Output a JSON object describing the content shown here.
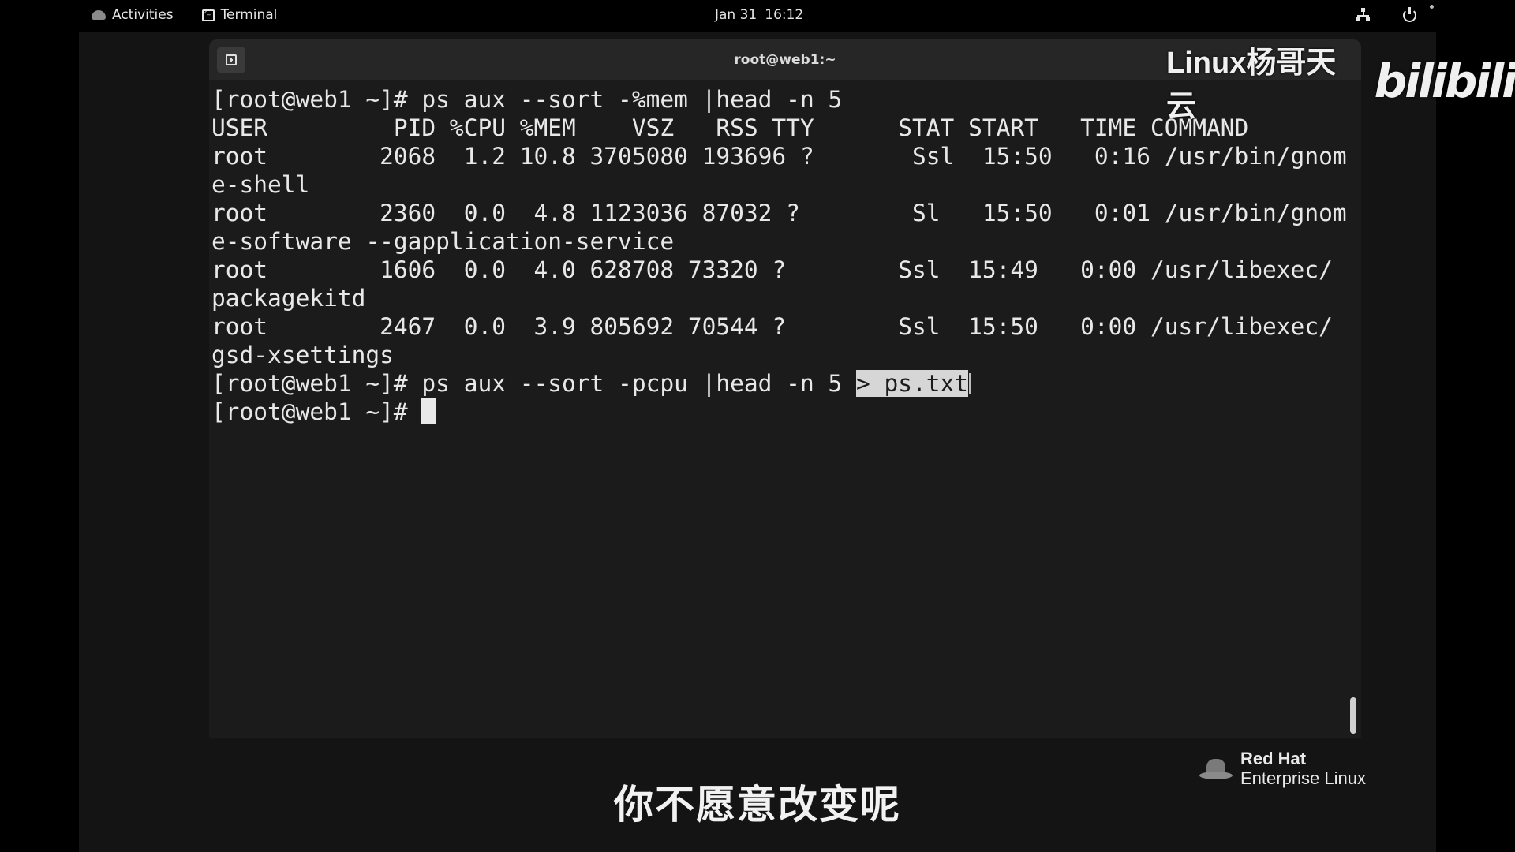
{
  "topbar": {
    "activities": "Activities",
    "app_name": "Terminal",
    "date": "Jan 31",
    "time": "16:12",
    "icons": [
      "network-icon",
      "power-icon"
    ]
  },
  "window": {
    "title": "root@web1:~",
    "new_tab_icon": "new-tab-icon"
  },
  "terminal": {
    "lines": [
      "[root@web1 ~]# ps aux --sort -%mem |head -n 5",
      "USER         PID %CPU %MEM    VSZ   RSS TTY      STAT START   TIME COMMAND",
      "root        2068  1.2 10.8 3705080 193696 ?       Ssl  15:50   0:16 /usr/bin/gnom",
      "e-shell",
      "root        2360  0.0  4.8 1123036 87032 ?        Sl   15:50   0:01 /usr/bin/gnom",
      "e-software --gapplication-service",
      "root        1606  0.0  4.0 628708 73320 ?        Ssl  15:49   0:00 /usr/libexec/",
      "packagekitd",
      "root        2467  0.0  3.9 805692 70544 ?        Ssl  15:50   0:00 /usr/libexec/",
      "gsd-xsettings"
    ],
    "cmd_prefix": "[root@web1 ~]# ps aux --sort -pcpu |head -n 5 ",
    "cmd_selected": "> ps.txt",
    "prompt": "[root@web1 ~]# "
  },
  "overlay": {
    "watermark": "Linux杨哥天云",
    "bili_logo": "bilibili",
    "redhat_line1": "Red Hat",
    "redhat_line2": "Enterprise Linux",
    "subtitle": "你不愿意改变呢"
  }
}
